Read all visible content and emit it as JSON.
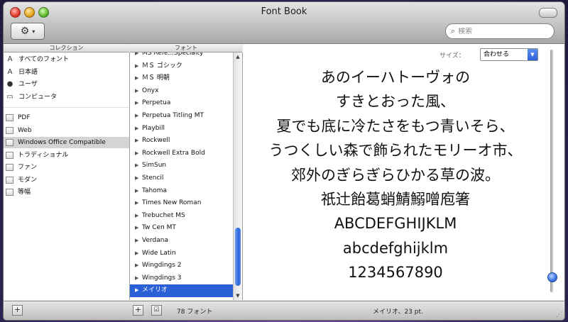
{
  "window": {
    "title": "Font Book"
  },
  "toolbar": {
    "action_icon": "gear-icon",
    "action_caret": "▾",
    "search_placeholder": "検索"
  },
  "collections": {
    "header": "コレクション",
    "items": [
      {
        "label": "すべてのフォント",
        "icon": "font-icon",
        "selected": false
      },
      {
        "label": "日本語",
        "icon": "font-icon",
        "selected": false
      },
      {
        "label": "ユーザ",
        "icon": "user-icon",
        "selected": false
      },
      {
        "label": "コンピュータ",
        "icon": "computer-icon",
        "selected": false
      },
      {
        "label": "PDF",
        "icon": "document-icon",
        "selected": false
      },
      {
        "label": "Web",
        "icon": "document-icon",
        "selected": false
      },
      {
        "label": "Windows Office Compatible",
        "icon": "document-icon",
        "selected": true
      },
      {
        "label": "トラディショナル",
        "icon": "document-icon",
        "selected": false
      },
      {
        "label": "ファン",
        "icon": "document-icon",
        "selected": false
      },
      {
        "label": "モダン",
        "icon": "document-icon",
        "selected": false
      },
      {
        "label": "等幅",
        "icon": "document-icon",
        "selected": false
      }
    ]
  },
  "fonts": {
    "header": "フォント",
    "items": [
      {
        "label": "MS Refe...Specialty",
        "selected": false
      },
      {
        "label": "ＭＳ ゴシック",
        "selected": false
      },
      {
        "label": "ＭＳ 明朝",
        "selected": false
      },
      {
        "label": "Onyx",
        "selected": false
      },
      {
        "label": "Perpetua",
        "selected": false
      },
      {
        "label": "Perpetua Titling MT",
        "selected": false
      },
      {
        "label": "Playbill",
        "selected": false
      },
      {
        "label": "Rockwell",
        "selected": false
      },
      {
        "label": "Rockwell Extra Bold",
        "selected": false
      },
      {
        "label": "SimSun",
        "selected": false
      },
      {
        "label": "Stencil",
        "selected": false
      },
      {
        "label": "Tahoma",
        "selected": false
      },
      {
        "label": "Times New Roman",
        "selected": false
      },
      {
        "label": "Trebuchet MS",
        "selected": false
      },
      {
        "label": "Tw Cen MT",
        "selected": false
      },
      {
        "label": "Verdana",
        "selected": false
      },
      {
        "label": "Wide Latin",
        "selected": false
      },
      {
        "label": "Wingdings 2",
        "selected": false
      },
      {
        "label": "Wingdings 3",
        "selected": false
      },
      {
        "label": "メイリオ",
        "selected": true
      }
    ]
  },
  "preview": {
    "size_label": "サイズ：",
    "size_value": "合わせる",
    "lines": [
      "あのイーハトーヴォの",
      "すきとおった風、",
      "夏でも底に冷たさをもつ青いそら、",
      "うつくしい森で飾られたモリーオ市、",
      "郊外のぎらぎらひかる草の波。",
      "祇辻飴葛蛸鯖鰯噌庖箸",
      "ABCDEFGHIJKLM",
      "abcdefghijklm",
      "1234567890"
    ]
  },
  "bottombar": {
    "add_label": "+",
    "add_font_label": "+",
    "font_count": "78 フォント",
    "status": "メイリオ、23 pt."
  }
}
